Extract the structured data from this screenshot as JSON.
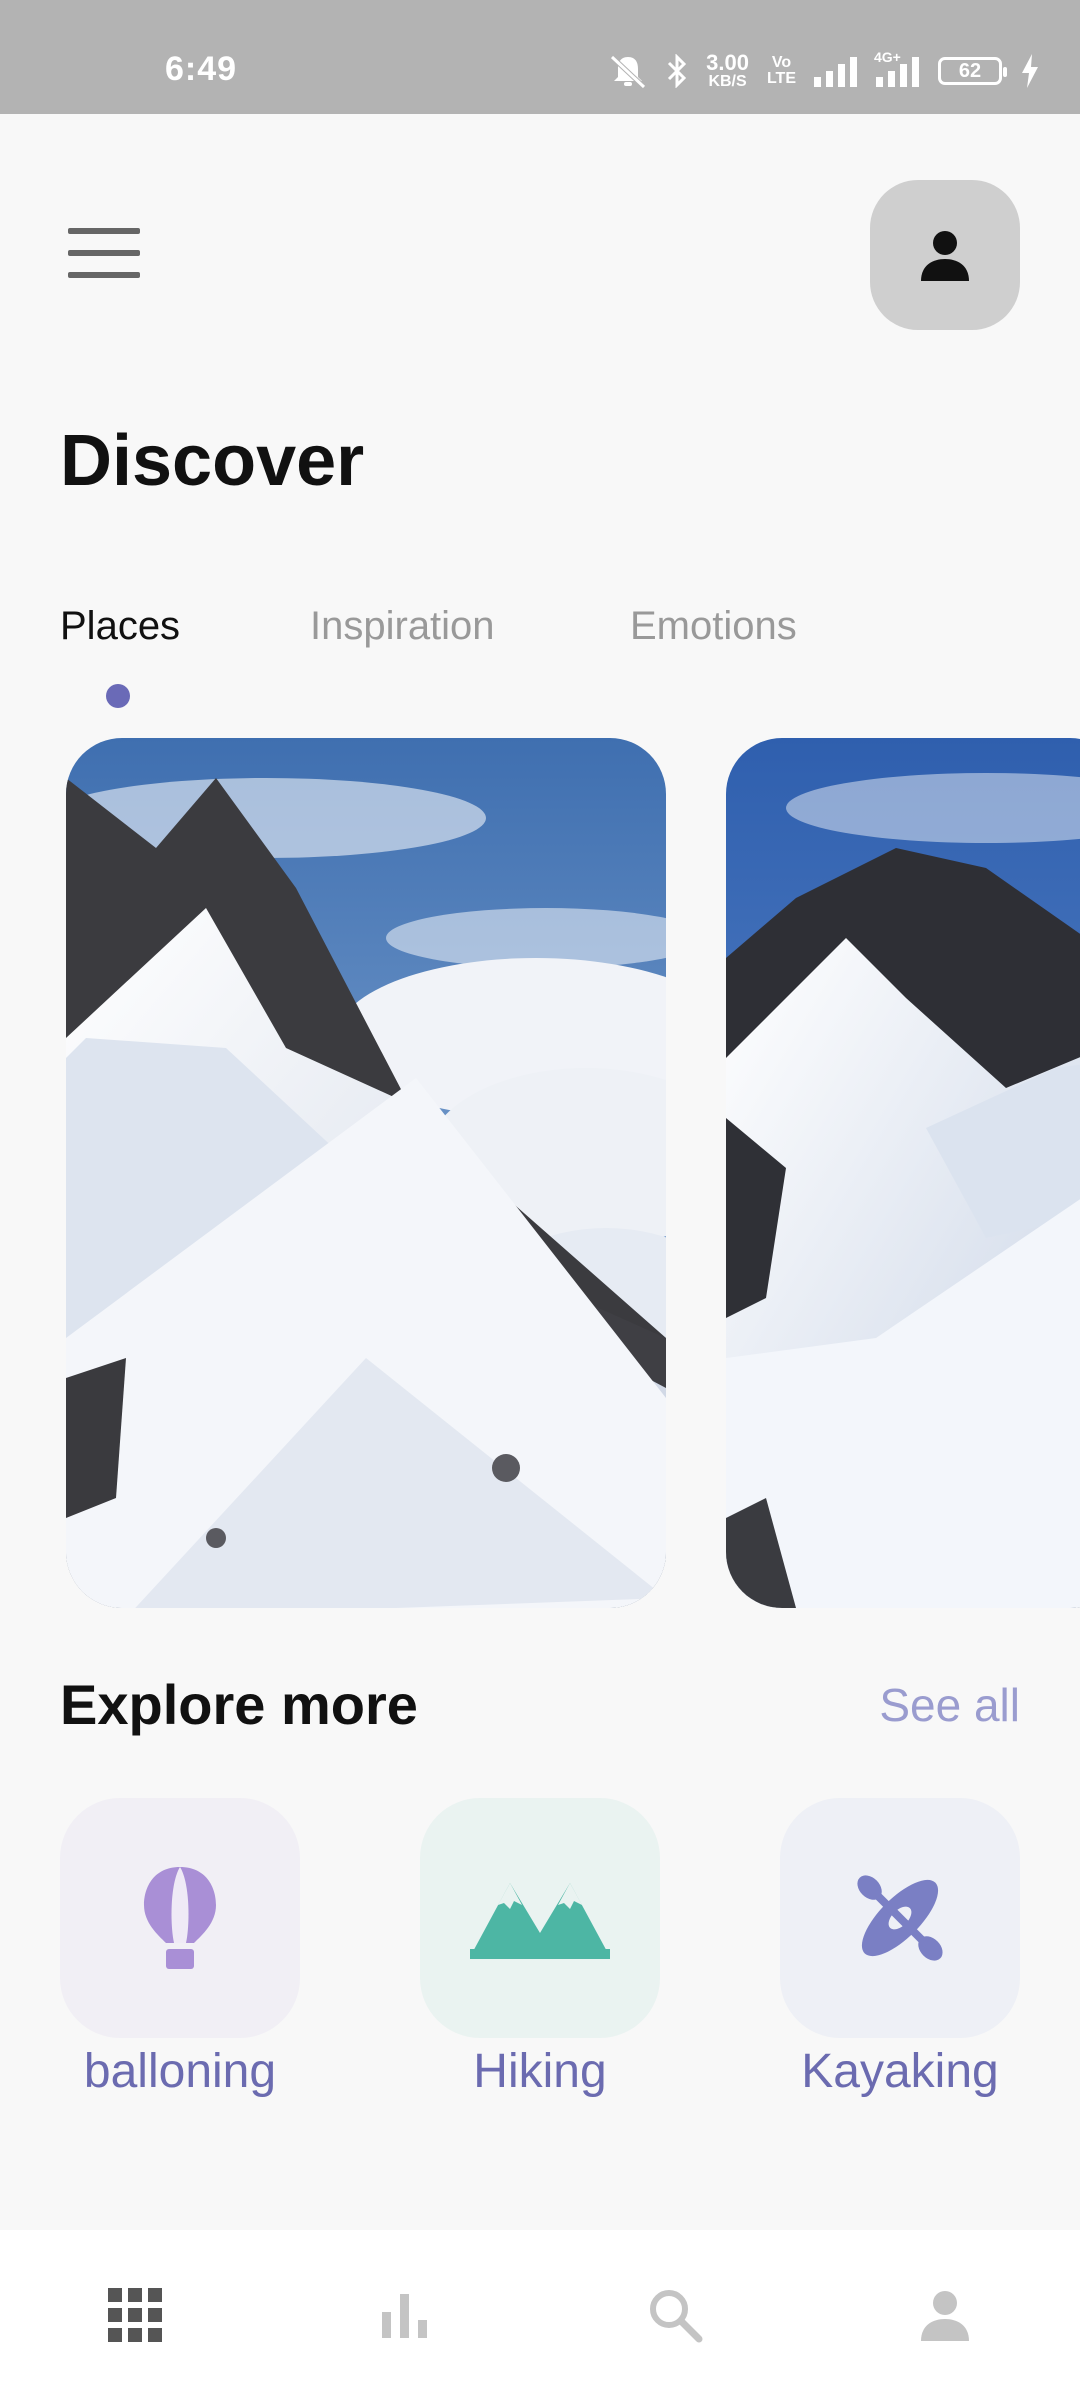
{
  "status_bar": {
    "time": "6:49",
    "speed_value": "3.00",
    "speed_unit": "KB/S",
    "volte_top": "Vo",
    "volte_bottom": "LTE",
    "network": "4G+",
    "battery": "62"
  },
  "header": {
    "menu_icon": "hamburger-icon",
    "profile_icon": "person-icon"
  },
  "page": {
    "title": "Discover"
  },
  "tabs": [
    {
      "label": "Places",
      "active": true
    },
    {
      "label": "Inspiration",
      "active": false
    },
    {
      "label": "Emotions",
      "active": false
    }
  ],
  "cards": [
    {
      "image": "snowy-mountain-ridge"
    },
    {
      "image": "snowy-mountain-peak"
    }
  ],
  "explore": {
    "title": "Explore more",
    "see_all": "See all",
    "categories": [
      {
        "label": "balloning",
        "icon": "hot-air-balloon-icon",
        "color": "#a98fd6"
      },
      {
        "label": "Hiking",
        "icon": "mountains-icon",
        "color": "#4db6a4"
      },
      {
        "label": "Kayaking",
        "icon": "kayak-icon",
        "color": "#7a7fc4"
      }
    ]
  },
  "bottom_nav": [
    {
      "icon": "grid-icon",
      "active": true
    },
    {
      "icon": "bar-chart-icon",
      "active": false
    },
    {
      "icon": "search-icon",
      "active": false
    },
    {
      "icon": "person-icon",
      "active": false
    }
  ]
}
